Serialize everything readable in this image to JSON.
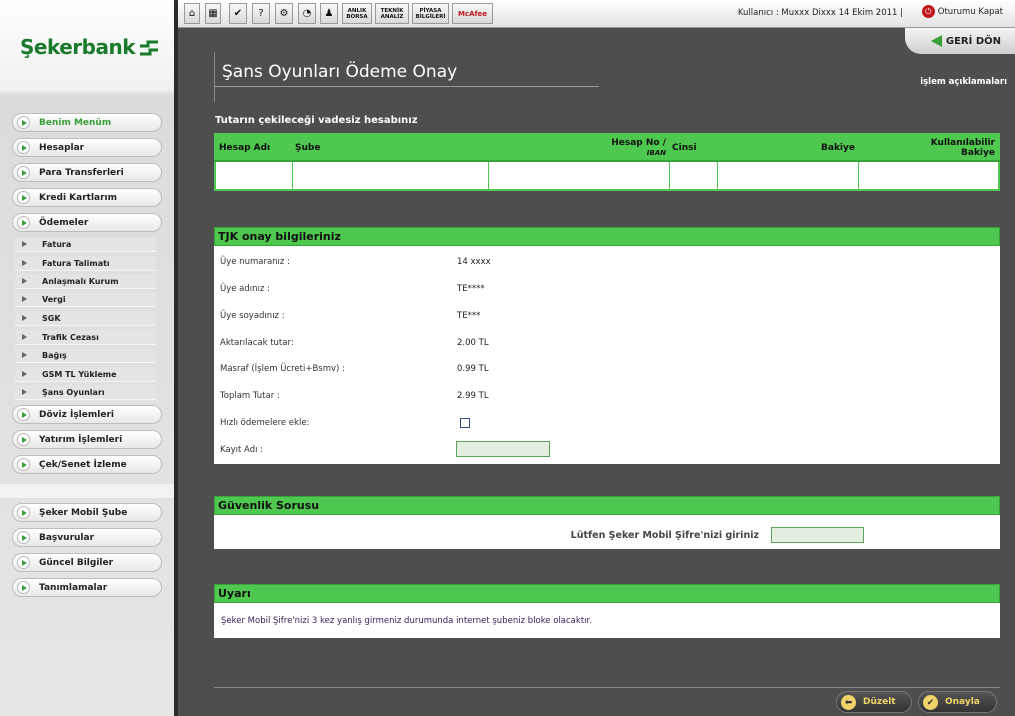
{
  "brand": {
    "name": "Şekerbank"
  },
  "toolbar": {
    "buttons": [
      {
        "icon": "home-icon",
        "glyph": "⌂"
      },
      {
        "icon": "calculator-icon",
        "glyph": "▦"
      },
      {
        "icon": "check-icon",
        "glyph": "✔"
      },
      {
        "icon": "help-icon",
        "glyph": "?"
      },
      {
        "icon": "settings-icon",
        "glyph": "⚙"
      },
      {
        "icon": "clock-icon",
        "glyph": "◔"
      },
      {
        "icon": "user-icon",
        "glyph": "♟"
      }
    ],
    "anlik_borsa": "ANLIK BORSA",
    "teknik_analiz": "TEKNİK ANALİZ",
    "piyasa_bilgileri": "PİYASA BİLGİLERİ",
    "mcafee": "McAfee",
    "user_info": "Kullanıcı : Muxxx Dixxx  14 Ekim 2011  |",
    "logout": "Oturumu Kapat"
  },
  "header": {
    "back": "GERİ DÖN",
    "title": "Şans Oyunları Ödeme Onay",
    "help": "işlem açıklamaları"
  },
  "sidebar": {
    "main_items": [
      {
        "label": "Benim Menüm"
      },
      {
        "label": "Hesaplar"
      },
      {
        "label": "Para Transferleri"
      },
      {
        "label": "Kredi Kartlarım"
      },
      {
        "label": "Ödemeler"
      }
    ],
    "sub_items": [
      {
        "label": "Fatura"
      },
      {
        "label": "Fatura Talimatı"
      },
      {
        "label": "Anlaşmalı Kurum"
      },
      {
        "label": "Vergi"
      },
      {
        "label": "SGK"
      },
      {
        "label": "Trafik Cezası"
      },
      {
        "label": "Bağış"
      },
      {
        "label": "GSM TL Yükleme"
      },
      {
        "label": "Şans Oyunları"
      }
    ],
    "more_items": [
      {
        "label": "Döviz İşlemleri"
      },
      {
        "label": "Yatırım İşlemleri"
      },
      {
        "label": "Çek/Senet İzleme"
      }
    ],
    "bottom_items": [
      {
        "label": "Şeker Mobil Şube"
      },
      {
        "label": "Başvurular"
      },
      {
        "label": "Güncel Bilgiler"
      },
      {
        "label": "Tanımlamalar"
      }
    ]
  },
  "account": {
    "label": "Tutarın çekileceği vadesiz hesabınız",
    "columns": {
      "hesap_adi": "Hesap Adı",
      "sube": "Şube",
      "hesap_no": "Hesap No /",
      "iban": "IBAN",
      "cinsi": "Cinsi",
      "bakiye": "Bakiye",
      "kullanilabilir": "Kullanılabilir",
      "kullanilabilir_2": "Bakiye"
    }
  },
  "tjk": {
    "title": "TJK onay bilgileriniz",
    "rows": [
      {
        "label": "Üye numaranız :",
        "value": "14 xxxx"
      },
      {
        "label": "Üye adınız :",
        "value": "TE****"
      },
      {
        "label": "Üye soyadınız :",
        "value": "TE***"
      },
      {
        "label": "Aktarılacak tutar:",
        "value": "2.00 TL"
      },
      {
        "label": "Masraf (İşlem Ücreti+Bsmv) :",
        "value": "0.99 TL"
      },
      {
        "label": "Toplam Tutar :",
        "value": "2.99 TL"
      }
    ],
    "quick_label": "Hızlı ödemelere ekle:",
    "record_label": "Kayıt Adı :"
  },
  "security": {
    "title": "Güvenlik Sorusu",
    "prompt": "Lütfen Şeker Mobil Şifre'nizi giriniz"
  },
  "warning": {
    "title": "Uyarı",
    "text": "Şeker Mobil Şifre'nizi 3 kez yanlış girmeniz durumunda internet şubeniz bloke olacaktır."
  },
  "footer": {
    "edit": "Düzelt",
    "confirm": "Onayla"
  },
  "colors": {
    "accent": "#4ec84e",
    "brand": "#1a7a2c",
    "background": "#4e4e4e"
  }
}
